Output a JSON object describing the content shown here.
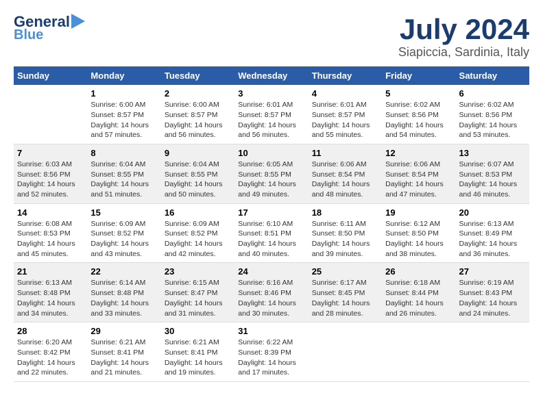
{
  "header": {
    "logo_line1": "General",
    "logo_line2": "Blue",
    "title": "July 2024",
    "location": "Siapiccia, Sardinia, Italy"
  },
  "weekdays": [
    "Sunday",
    "Monday",
    "Tuesday",
    "Wednesday",
    "Thursday",
    "Friday",
    "Saturday"
  ],
  "weeks": [
    [
      {
        "day": "",
        "info": ""
      },
      {
        "day": "1",
        "info": "Sunrise: 6:00 AM\nSunset: 8:57 PM\nDaylight: 14 hours\nand 57 minutes."
      },
      {
        "day": "2",
        "info": "Sunrise: 6:00 AM\nSunset: 8:57 PM\nDaylight: 14 hours\nand 56 minutes."
      },
      {
        "day": "3",
        "info": "Sunrise: 6:01 AM\nSunset: 8:57 PM\nDaylight: 14 hours\nand 56 minutes."
      },
      {
        "day": "4",
        "info": "Sunrise: 6:01 AM\nSunset: 8:57 PM\nDaylight: 14 hours\nand 55 minutes."
      },
      {
        "day": "5",
        "info": "Sunrise: 6:02 AM\nSunset: 8:56 PM\nDaylight: 14 hours\nand 54 minutes."
      },
      {
        "day": "6",
        "info": "Sunrise: 6:02 AM\nSunset: 8:56 PM\nDaylight: 14 hours\nand 53 minutes."
      }
    ],
    [
      {
        "day": "7",
        "info": "Sunrise: 6:03 AM\nSunset: 8:56 PM\nDaylight: 14 hours\nand 52 minutes."
      },
      {
        "day": "8",
        "info": "Sunrise: 6:04 AM\nSunset: 8:55 PM\nDaylight: 14 hours\nand 51 minutes."
      },
      {
        "day": "9",
        "info": "Sunrise: 6:04 AM\nSunset: 8:55 PM\nDaylight: 14 hours\nand 50 minutes."
      },
      {
        "day": "10",
        "info": "Sunrise: 6:05 AM\nSunset: 8:55 PM\nDaylight: 14 hours\nand 49 minutes."
      },
      {
        "day": "11",
        "info": "Sunrise: 6:06 AM\nSunset: 8:54 PM\nDaylight: 14 hours\nand 48 minutes."
      },
      {
        "day": "12",
        "info": "Sunrise: 6:06 AM\nSunset: 8:54 PM\nDaylight: 14 hours\nand 47 minutes."
      },
      {
        "day": "13",
        "info": "Sunrise: 6:07 AM\nSunset: 8:53 PM\nDaylight: 14 hours\nand 46 minutes."
      }
    ],
    [
      {
        "day": "14",
        "info": "Sunrise: 6:08 AM\nSunset: 8:53 PM\nDaylight: 14 hours\nand 45 minutes."
      },
      {
        "day": "15",
        "info": "Sunrise: 6:09 AM\nSunset: 8:52 PM\nDaylight: 14 hours\nand 43 minutes."
      },
      {
        "day": "16",
        "info": "Sunrise: 6:09 AM\nSunset: 8:52 PM\nDaylight: 14 hours\nand 42 minutes."
      },
      {
        "day": "17",
        "info": "Sunrise: 6:10 AM\nSunset: 8:51 PM\nDaylight: 14 hours\nand 40 minutes."
      },
      {
        "day": "18",
        "info": "Sunrise: 6:11 AM\nSunset: 8:50 PM\nDaylight: 14 hours\nand 39 minutes."
      },
      {
        "day": "19",
        "info": "Sunrise: 6:12 AM\nSunset: 8:50 PM\nDaylight: 14 hours\nand 38 minutes."
      },
      {
        "day": "20",
        "info": "Sunrise: 6:13 AM\nSunset: 8:49 PM\nDaylight: 14 hours\nand 36 minutes."
      }
    ],
    [
      {
        "day": "21",
        "info": "Sunrise: 6:13 AM\nSunset: 8:48 PM\nDaylight: 14 hours\nand 34 minutes."
      },
      {
        "day": "22",
        "info": "Sunrise: 6:14 AM\nSunset: 8:48 PM\nDaylight: 14 hours\nand 33 minutes."
      },
      {
        "day": "23",
        "info": "Sunrise: 6:15 AM\nSunset: 8:47 PM\nDaylight: 14 hours\nand 31 minutes."
      },
      {
        "day": "24",
        "info": "Sunrise: 6:16 AM\nSunset: 8:46 PM\nDaylight: 14 hours\nand 30 minutes."
      },
      {
        "day": "25",
        "info": "Sunrise: 6:17 AM\nSunset: 8:45 PM\nDaylight: 14 hours\nand 28 minutes."
      },
      {
        "day": "26",
        "info": "Sunrise: 6:18 AM\nSunset: 8:44 PM\nDaylight: 14 hours\nand 26 minutes."
      },
      {
        "day": "27",
        "info": "Sunrise: 6:19 AM\nSunset: 8:43 PM\nDaylight: 14 hours\nand 24 minutes."
      }
    ],
    [
      {
        "day": "28",
        "info": "Sunrise: 6:20 AM\nSunset: 8:42 PM\nDaylight: 14 hours\nand 22 minutes."
      },
      {
        "day": "29",
        "info": "Sunrise: 6:21 AM\nSunset: 8:41 PM\nDaylight: 14 hours\nand 21 minutes."
      },
      {
        "day": "30",
        "info": "Sunrise: 6:21 AM\nSunset: 8:41 PM\nDaylight: 14 hours\nand 19 minutes."
      },
      {
        "day": "31",
        "info": "Sunrise: 6:22 AM\nSunset: 8:39 PM\nDaylight: 14 hours\nand 17 minutes."
      },
      {
        "day": "",
        "info": ""
      },
      {
        "day": "",
        "info": ""
      },
      {
        "day": "",
        "info": ""
      }
    ]
  ]
}
